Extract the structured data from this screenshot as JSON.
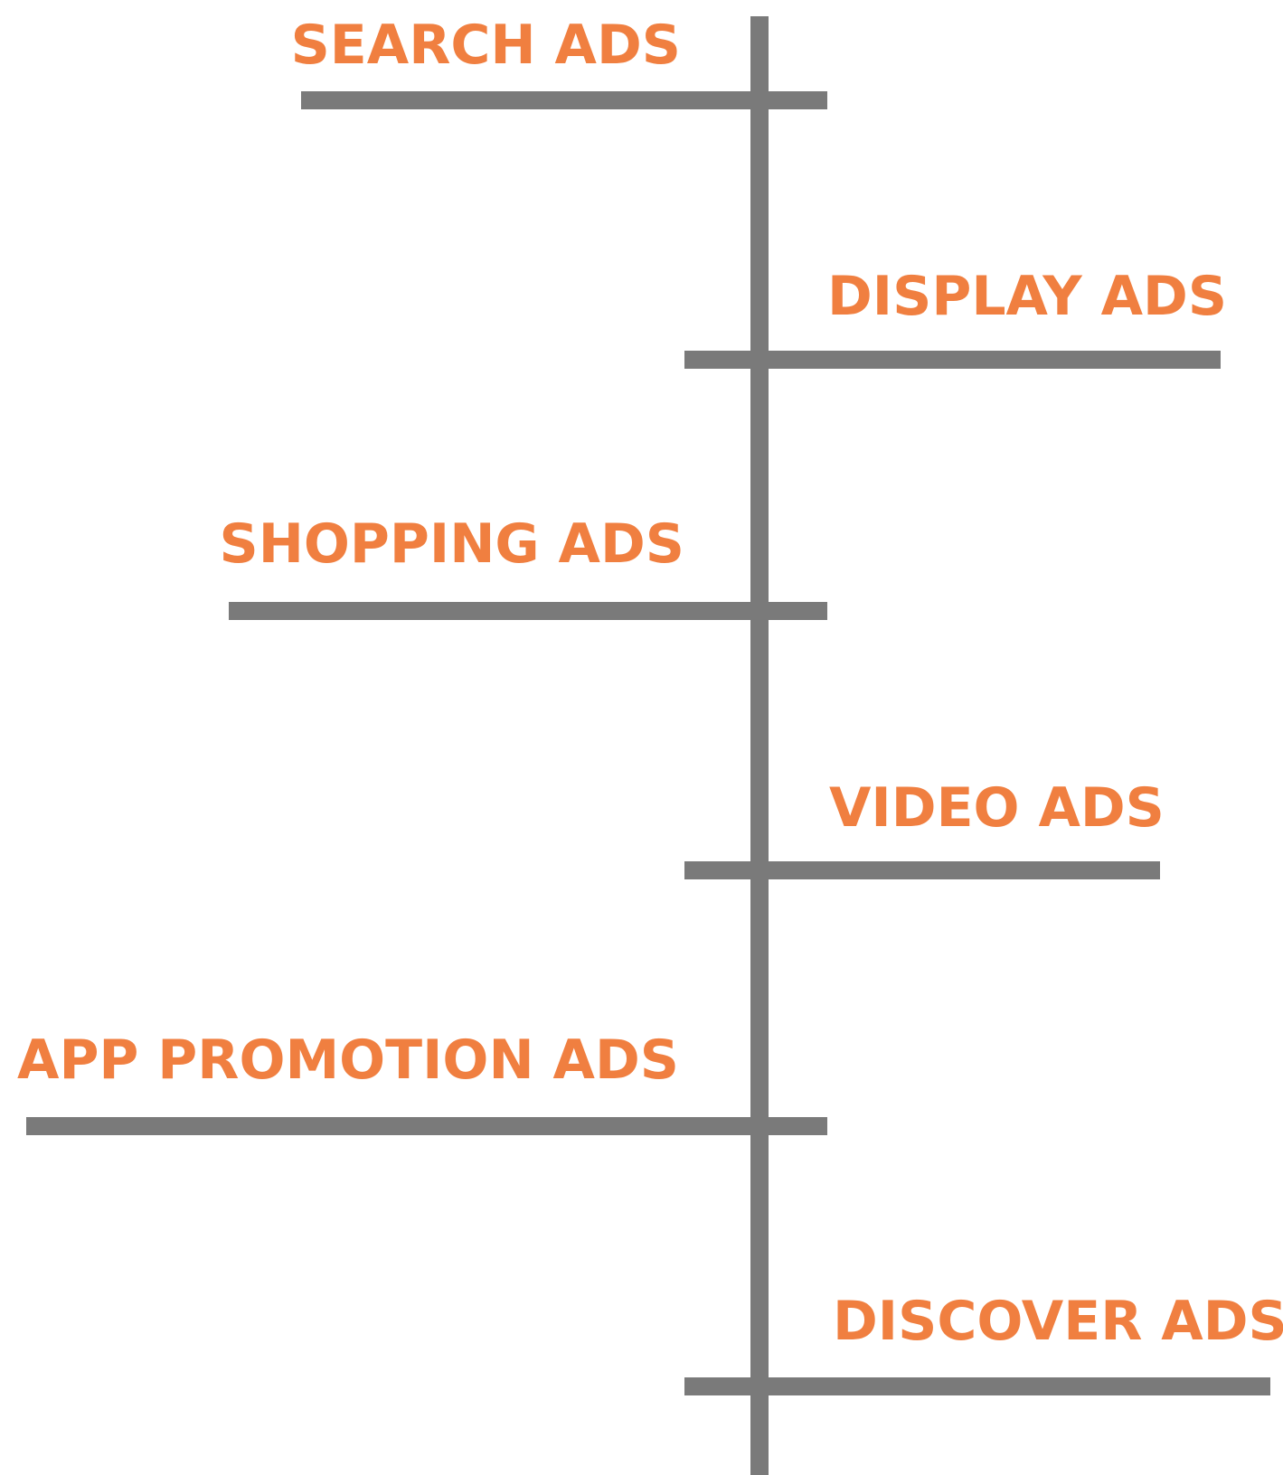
{
  "colors": {
    "label": "#f07f40",
    "line": "#7a7a7a",
    "background": "#ffffff"
  },
  "items": [
    {
      "label": "SEARCH ADS"
    },
    {
      "label": "DISPLAY ADS"
    },
    {
      "label": "SHOPPING ADS"
    },
    {
      "label": "VIDEO ADS"
    },
    {
      "label": "APP PROMOTION ADS"
    },
    {
      "label": "DISCOVER ADS"
    }
  ]
}
